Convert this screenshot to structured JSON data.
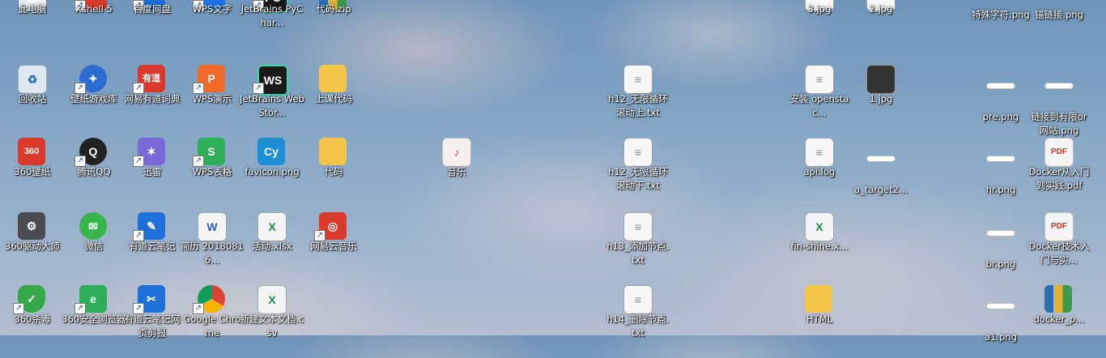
{
  "desktop": {
    "icons": [
      {
        "name": "this-pc-icon",
        "label": "此电脑",
        "glyph": "▣",
        "cls": "g-pc"
      },
      {
        "name": "xshell-icon",
        "label": "Xshell 5",
        "glyph": "X",
        "cls": "g-red"
      },
      {
        "name": "baidu-netdisk-icon",
        "label": "百度网盘",
        "glyph": "∞",
        "cls": "g-blue"
      },
      {
        "name": "wps-writer-icon",
        "label": "WPS文字",
        "glyph": "W",
        "cls": "g-wps"
      },
      {
        "name": "pycharm-icon",
        "label": "JetBrains PyChar...",
        "glyph": "PC",
        "cls": "g-jb"
      },
      {
        "name": "code-zip-icon",
        "label": "代码.zip",
        "glyph": "",
        "cls": "g-zip"
      },
      {
        "name": "3jpg-icon",
        "label": "3.jpg",
        "glyph": "",
        "cls": "g-doc"
      },
      {
        "name": "2jpg-icon",
        "label": "2.jpg",
        "glyph": "",
        "cls": "g-doc"
      },
      {
        "name": "special-char-png-icon",
        "label": "特殊字符.png",
        "glyph": "",
        "cls": "g-line"
      },
      {
        "name": "anchor-link-png-icon",
        "label": "锚链接.png",
        "glyph": "",
        "cls": "g-line"
      },
      {
        "name": "recycle-bin-icon",
        "label": "回收站",
        "glyph": "♻",
        "cls": "g-bin"
      },
      {
        "name": "wallpaper-game-icon",
        "label": "壁纸游戏库",
        "glyph": "✦",
        "cls": "g-gear"
      },
      {
        "name": "youdao-dict-icon",
        "label": "网易有道词典",
        "glyph": "有道",
        "cls": "g-red lg"
      },
      {
        "name": "wps-presentation-icon",
        "label": "WPS演示",
        "glyph": "P",
        "cls": "g-orange"
      },
      {
        "name": "webstorm-icon",
        "label": "JetBrains WebStor...",
        "glyph": "WS",
        "cls": "g-jb"
      },
      {
        "name": "class-code-folder-icon",
        "label": "上课代码",
        "glyph": "",
        "cls": "g-folder"
      },
      {
        "name": "h12-loop-up-txt-icon",
        "label": "h12_无限循环滚动上.txt",
        "glyph": "≡",
        "cls": "g-doc"
      },
      {
        "name": "install-openstack-icon",
        "label": "安装 openstac...",
        "glyph": "≡",
        "cls": "g-doc"
      },
      {
        "name": "1jpg-icon",
        "label": "1.jpg",
        "glyph": "",
        "cls": "g-photo"
      },
      {
        "name": "pre-png-icon",
        "label": "pre.png",
        "glyph": "",
        "cls": "g-line"
      },
      {
        "name": "link-website-png-icon",
        "label": "链接到有限or网站.png",
        "glyph": "",
        "cls": "g-line"
      },
      {
        "name": "360-wallpaper-icon",
        "label": "360壁纸",
        "glyph": "360",
        "cls": "g-red lg"
      },
      {
        "name": "tencent-qq-icon",
        "label": "腾讯QQ",
        "glyph": "Q",
        "cls": "g-qq"
      },
      {
        "name": "xunlei-icon",
        "label": "迅雷",
        "glyph": "✶",
        "cls": "g-purple"
      },
      {
        "name": "wps-spreadsheet-icon",
        "label": "WPS表格",
        "glyph": "S",
        "cls": "g-green"
      },
      {
        "name": "favicon-png-icon",
        "label": "favicon.png",
        "glyph": "Cy",
        "cls": "g-cyan"
      },
      {
        "name": "code-folder-icon",
        "label": "代码",
        "glyph": "",
        "cls": "g-folder"
      },
      {
        "name": "music-icon",
        "label": "音乐",
        "glyph": "♪",
        "cls": "g-music"
      },
      {
        "name": "h12-loop-down-txt-icon",
        "label": "h12_无限循环滚动下.txt",
        "glyph": "≡",
        "cls": "g-doc"
      },
      {
        "name": "api-log-icon",
        "label": "api.log",
        "glyph": "≡",
        "cls": "g-doc"
      },
      {
        "name": "a-target2-icon",
        "label": "a_target2...",
        "glyph": "",
        "cls": "g-line"
      },
      {
        "name": "hr-png-icon",
        "label": "hr.png",
        "glyph": "",
        "cls": "g-line"
      },
      {
        "name": "docker-practice-pdf-icon",
        "label": "Docker从入门到实践.pdf",
        "glyph": "PDF",
        "cls": "g-pdf"
      },
      {
        "name": "360-driver-icon",
        "label": "360驱动大师",
        "glyph": "⚙",
        "cls": "g-dark"
      },
      {
        "name": "wechat-icon",
        "label": "微信",
        "glyph": "✉",
        "cls": "g-wechat"
      },
      {
        "name": "youdao-note-icon",
        "label": "有道云笔记",
        "glyph": "✎",
        "cls": "g-blue"
      },
      {
        "name": "resume-icon",
        "label": "简历 20180816...",
        "glyph": "W",
        "cls": "g-word"
      },
      {
        "name": "activity-xlsx-icon",
        "label": "活动.xlsx",
        "glyph": "X",
        "cls": "g-excel"
      },
      {
        "name": "netease-music-icon",
        "label": "网易云音乐",
        "glyph": "◎",
        "cls": "g-red"
      },
      {
        "name": "h13-add-node-txt-icon",
        "label": "h13_添加节点.txt",
        "glyph": "≡",
        "cls": "g-doc"
      },
      {
        "name": "fin-shine-icon",
        "label": "fin-shine.x...",
        "glyph": "X",
        "cls": "g-excel"
      },
      {
        "name": "br-png-icon",
        "label": "br.png",
        "glyph": "",
        "cls": "g-line"
      },
      {
        "name": "docker-tech-icon",
        "label": "Docker技术入门与实...",
        "glyph": "PDF",
        "cls": "g-pdf"
      },
      {
        "name": "360-antivirus-icon",
        "label": "360杀毒",
        "glyph": "✓",
        "cls": "g-shield"
      },
      {
        "name": "360-browser-icon",
        "label": "360安全浏览器",
        "glyph": "e",
        "cls": "g-green"
      },
      {
        "name": "youdao-web-clip-icon",
        "label": "有道云笔记网页剪报",
        "glyph": "✂",
        "cls": "g-blue"
      },
      {
        "name": "google-chrome-icon",
        "label": "Google Chrome",
        "glyph": "",
        "cls": "g-chrome"
      },
      {
        "name": "new-text-doc-icon",
        "label": "新建文本文档.csv",
        "glyph": "X",
        "cls": "g-excel"
      },
      {
        "name": "h14-delete-node-icon",
        "label": "h14_删除节点.txt",
        "glyph": "≡",
        "cls": "g-doc"
      },
      {
        "name": "html-folder-icon",
        "label": "HTML",
        "glyph": "",
        "cls": "g-folder"
      },
      {
        "name": "a1-png-icon",
        "label": "a1.png",
        "glyph": "",
        "cls": "g-line"
      },
      {
        "name": "docker-p-icon",
        "label": "docker_p...",
        "glyph": "",
        "cls": "g-zip"
      }
    ]
  }
}
